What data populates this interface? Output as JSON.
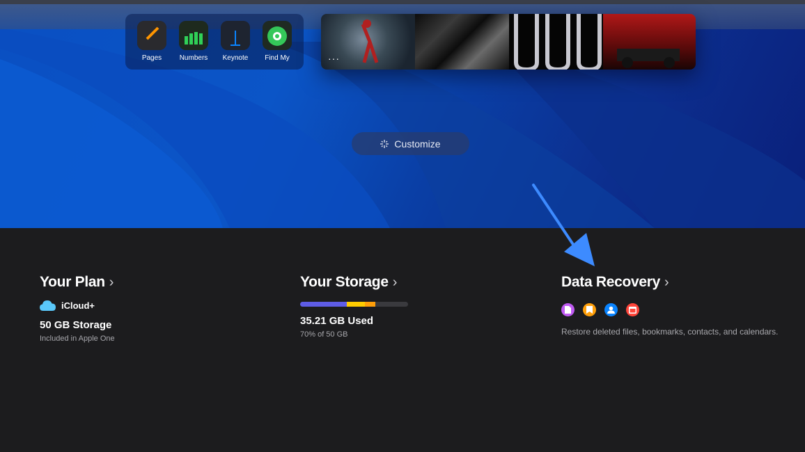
{
  "apps": [
    {
      "label": "Pages",
      "icon": "pages-icon"
    },
    {
      "label": "Numbers",
      "icon": "numbers-icon"
    },
    {
      "label": "Keynote",
      "icon": "keynote-icon"
    },
    {
      "label": "Find My",
      "icon": "find-my-icon"
    }
  ],
  "photos": {
    "more_label": "···"
  },
  "customize": {
    "label": "Customize",
    "icon": "sparkle-icon"
  },
  "plan": {
    "title": "Your Plan",
    "plan_name": "iCloud+",
    "storage": "50 GB Storage",
    "note": "Included in Apple One"
  },
  "storage": {
    "title": "Your Storage",
    "used": "35.21 GB Used",
    "percent_text": "70% of 50 GB",
    "used_fraction": 0.7,
    "segments": [
      {
        "color": "#5e5ce6",
        "fraction": 0.43
      },
      {
        "color": "#ffcc00",
        "fraction": 0.17
      },
      {
        "color": "#ff9f0a",
        "fraction": 0.1
      }
    ]
  },
  "recovery": {
    "title": "Data Recovery",
    "description": "Restore deleted files, bookmarks, contacts, and calendars.",
    "icons": [
      {
        "name": "files-icon",
        "color": "#bf5af2"
      },
      {
        "name": "bookmarks-icon",
        "color": "#ff9f0a"
      },
      {
        "name": "contacts-icon",
        "color": "#0a84ff"
      },
      {
        "name": "calendars-icon",
        "color": "#ff453a"
      }
    ]
  },
  "colors": {
    "accent_arrow": "#3d8bff",
    "background_dark": "#1c1c1e",
    "hero_blue": "#0b55c7"
  }
}
